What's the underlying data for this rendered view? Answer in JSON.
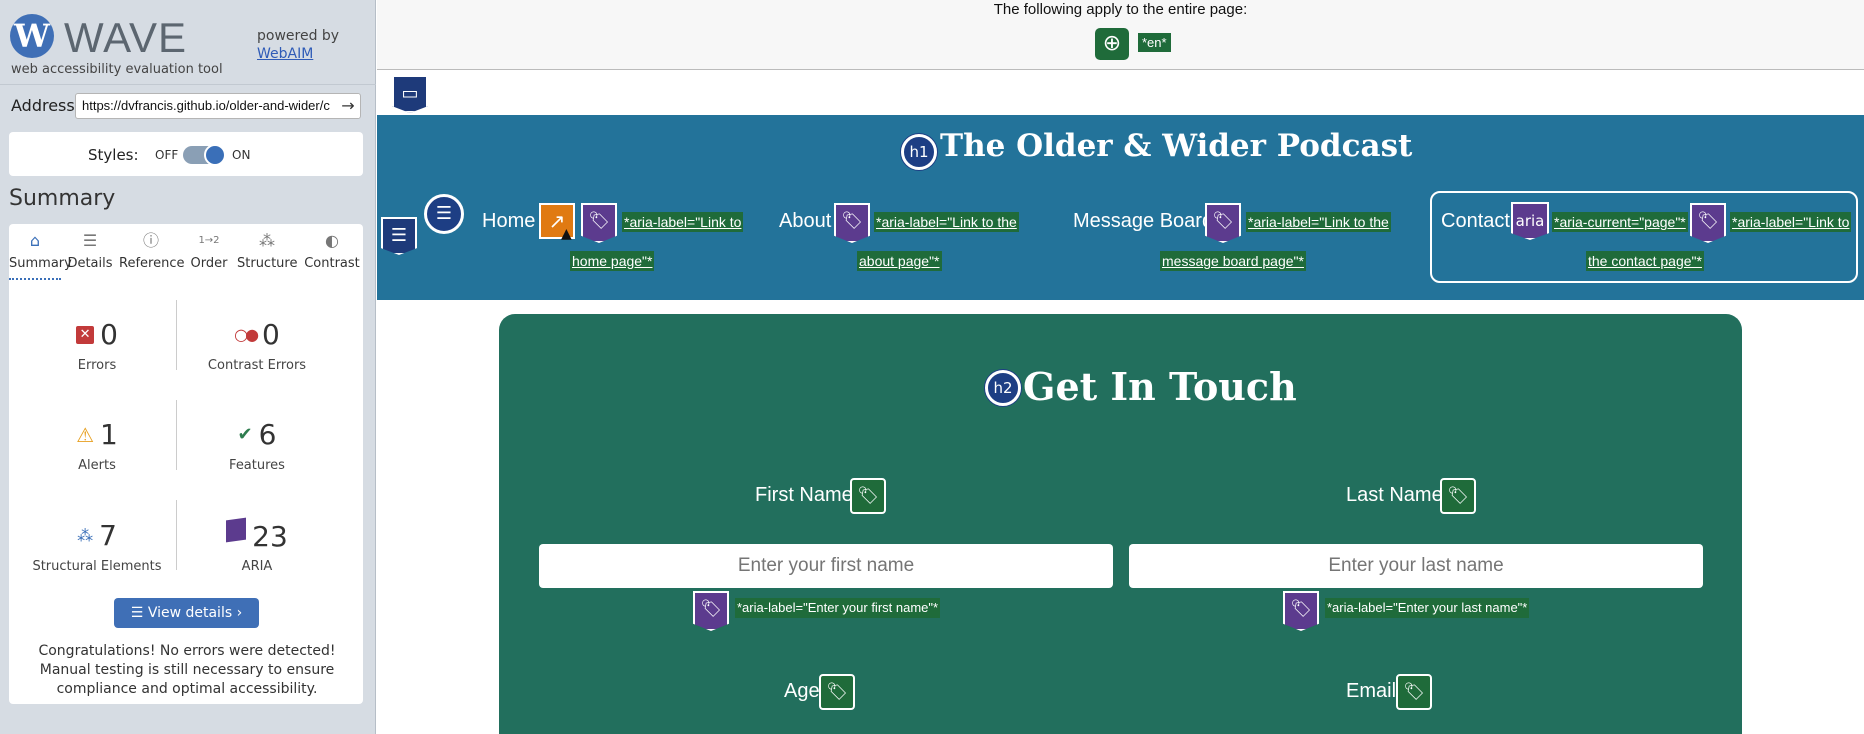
{
  "wave": {
    "brand": "WAVE",
    "tagline": "web accessibility evaluation tool",
    "powered_by": "powered by",
    "webaim": "WebAIM",
    "address_label": "Address:",
    "address_value": "https://dvfrancis.github.io/older-and-wider/c",
    "styles_label": "Styles:",
    "styles_off": "OFF",
    "styles_on": "ON",
    "summary_heading": "Summary",
    "tabs": [
      {
        "label": "Summary",
        "icon": "home-icon"
      },
      {
        "label": "Details",
        "icon": "list-icon"
      },
      {
        "label": "Reference",
        "icon": "info-icon"
      },
      {
        "label": "Order",
        "icon": "order-icon"
      },
      {
        "label": "Structure",
        "icon": "structure-icon"
      },
      {
        "label": "Contrast",
        "icon": "contrast-icon"
      }
    ],
    "stats": {
      "errors": {
        "count": "0",
        "label": "Errors"
      },
      "contrast_errors": {
        "count": "0",
        "label": "Contrast Errors"
      },
      "alerts": {
        "count": "1",
        "label": "Alerts"
      },
      "features": {
        "count": "6",
        "label": "Features"
      },
      "structural": {
        "count": "7",
        "label": "Structural Elements"
      },
      "aria": {
        "count": "23",
        "label": "ARIA"
      }
    },
    "view_details": "View details ›",
    "congrats": "Congratulations! No errors were detected! Manual testing is still necessary to ensure compliance and optimal accessibility."
  },
  "page": {
    "applies_text": "The following apply to the entire page:",
    "lang_tag": "*en*",
    "site_title": "The Older & Wider Podcast",
    "h1_badge": "h1",
    "h2_badge": "h2",
    "nav": [
      {
        "label": "Home",
        "aria_line1": "*aria-label=\"Link to",
        "aria_line2": "home page\"*"
      },
      {
        "label": "About",
        "aria_line1": "*aria-label=\"Link to the",
        "aria_line2": "about page\"*"
      },
      {
        "label": "Message Board",
        "aria_line1": "*aria-label=\"Link to the",
        "aria_line2": "message board page\"*"
      },
      {
        "label": "Contact",
        "aria_current": "*aria-current=\"page\"*",
        "aria_badge": "aria",
        "aria_line1": "*aria-label=\"Link to",
        "aria_line2": "the contact page\"*"
      }
    ],
    "form_title": "Get In Touch",
    "fields": {
      "first_name": {
        "label": "First Name",
        "placeholder": "Enter your first name",
        "aria": "*aria-label=\"Enter your first name\"*"
      },
      "last_name": {
        "label": "Last Name",
        "placeholder": "Enter your last name",
        "aria": "*aria-label=\"Enter your last name\"*"
      },
      "age": {
        "label": "Age"
      },
      "email": {
        "label": "Email"
      }
    }
  },
  "colors": {
    "banner": "#23739a",
    "form_card": "#226f5d",
    "aria_label_bg": "#1f6b3a",
    "tag_purple": "#5c3b8e"
  }
}
